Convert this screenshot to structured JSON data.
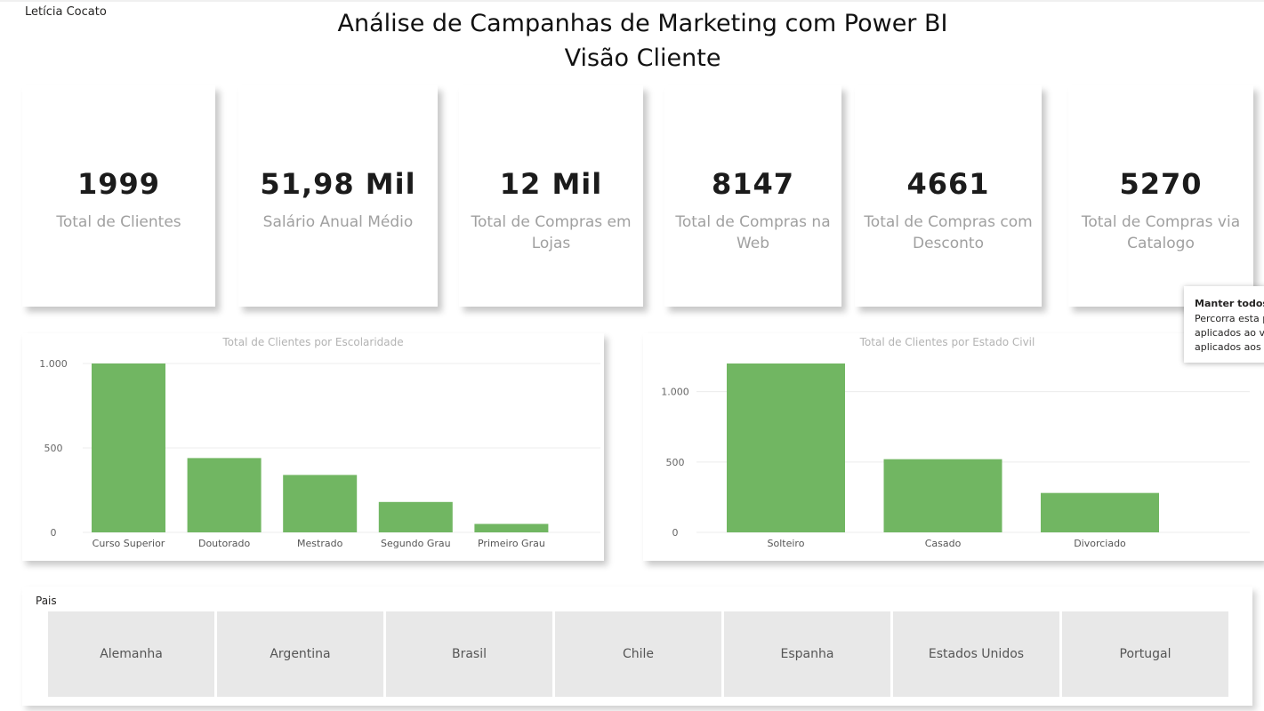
{
  "header": {
    "author": "Letícia Cocato",
    "title_line1": "Análise de Campanhas de Marketing com Power BI",
    "title_line2": "Visão Cliente"
  },
  "kpis": [
    {
      "value": "1999",
      "label": "Total de Clientes"
    },
    {
      "value": "51,98 Mil",
      "label": "Salário Anual Médio"
    },
    {
      "value": "12 Mil",
      "label": "Total de Compras em Lojas"
    },
    {
      "value": "8147",
      "label": "Total de Compras na Web"
    },
    {
      "value": "4661",
      "label": "Total de Compras com Desconto"
    },
    {
      "value": "5270",
      "label": "Total de Compras via Catalogo"
    }
  ],
  "tooltip": {
    "heading": "Manter todos",
    "lines": [
      "Percorra esta p",
      "aplicados ao vi",
      "aplicados aos c"
    ]
  },
  "chart_data": [
    {
      "type": "bar",
      "title": "Total de Clientes por Escolaridade",
      "categories": [
        "Curso Superior",
        "Doutorado",
        "Mestrado",
        "Segundo Grau",
        "Primeiro Grau"
      ],
      "values": [
        1000,
        440,
        340,
        180,
        50
      ],
      "ylim": [
        0,
        1000
      ],
      "yticks": [
        0,
        500,
        1000
      ],
      "ytick_labels": [
        "0",
        "500",
        "1.000"
      ],
      "color": "#71b662",
      "grid": true
    },
    {
      "type": "bar",
      "title": "Total de Clientes por Estado Civil",
      "categories": [
        "Solteiro",
        "Casado",
        "Divorciado"
      ],
      "values": [
        1200,
        520,
        280
      ],
      "ylim": [
        0,
        1200
      ],
      "yticks": [
        0,
        500,
        1000
      ],
      "ytick_labels": [
        "0",
        "500",
        "1.000"
      ],
      "color": "#71b662",
      "grid": true
    }
  ],
  "slicer": {
    "label": "Pais",
    "options": [
      "Alemanha",
      "Argentina",
      "Brasil",
      "Chile",
      "Espanha",
      "Estados Unidos",
      "Portugal"
    ]
  }
}
